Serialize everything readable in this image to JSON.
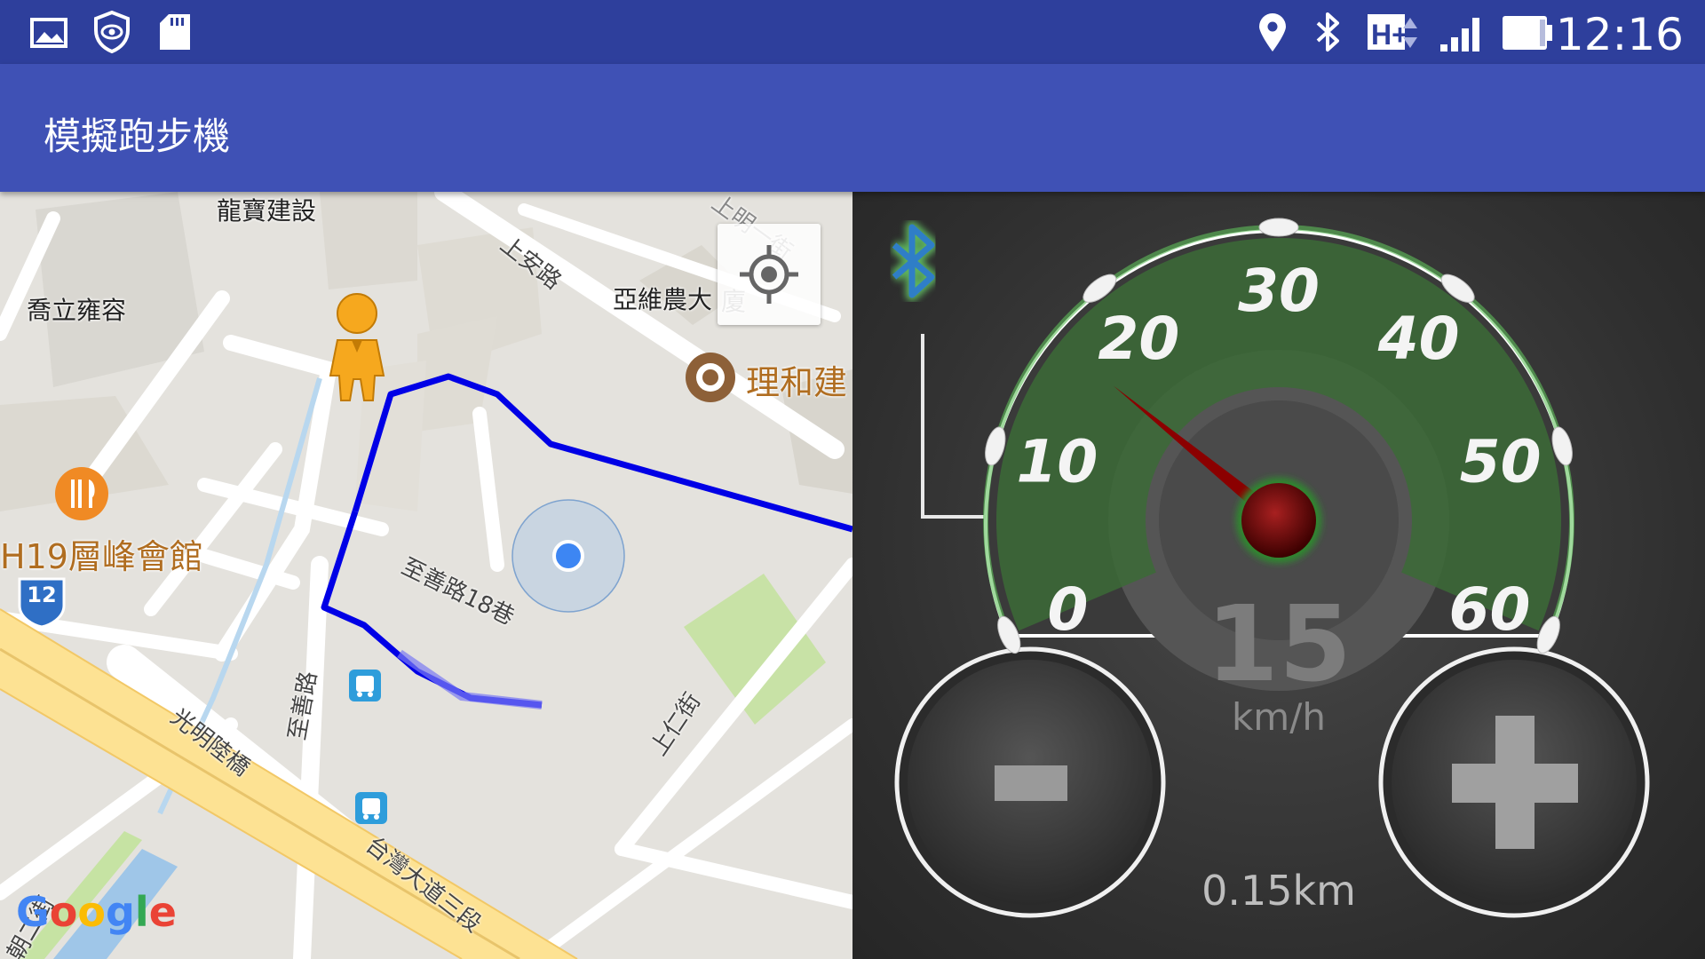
{
  "status_bar": {
    "time": "12:16",
    "left_icons": [
      "image-icon",
      "shield-eye-icon",
      "sd-card-icon"
    ],
    "right_icons": [
      "location-icon",
      "bluetooth-icon",
      "network-hplus-icon",
      "signal-icon",
      "battery-icon"
    ],
    "network_type": "H+"
  },
  "app_bar": {
    "title": "模擬跑步機"
  },
  "map": {
    "labels": {
      "longbao": "龍寶建設",
      "qiaoli": "喬立雍容",
      "yawei": "亞維農大",
      "yawei_fade": "廈",
      "lihe": "理和建",
      "h19": "H19層峰會館",
      "road_shanganlu": "上安路",
      "road_shangming": "上明一街",
      "road_zhishan_lane": "至善路18巷",
      "road_zhishan": "至善路",
      "road_guangming_bridge": "光明陸橋",
      "road_taiwan_blvd": "台灣大道三段",
      "road_shangren": "上仁街",
      "road_corner": "朝二街",
      "route_shield": "12"
    },
    "google_logo": [
      "G",
      "o",
      "o",
      "g",
      "l",
      "e"
    ]
  },
  "dashboard": {
    "gauge": {
      "ticks": [
        "0",
        "10",
        "20",
        "30",
        "40",
        "50",
        "60"
      ],
      "min": 0,
      "max": 60,
      "needle_value": 16.5
    },
    "speed_value": "15",
    "speed_unit": "km/h",
    "distance": "0.15km",
    "buttons": {
      "minus": "-",
      "plus": "+"
    },
    "bluetooth_status": "connected"
  },
  "colors": {
    "status_bar": "#2e3f9c",
    "app_bar": "#3f51b5",
    "route": "#0000e6",
    "gauge_green": "#3c6b37",
    "needle": "#8b0000"
  }
}
